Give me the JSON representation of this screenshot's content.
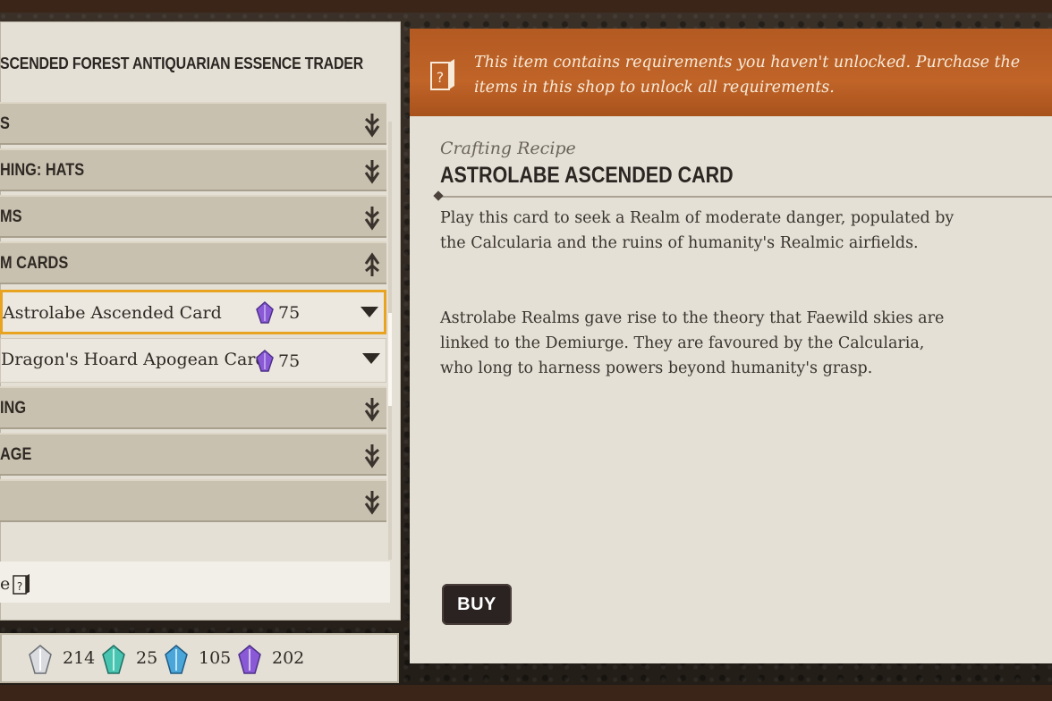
{
  "shop": {
    "title": "SCENDED FOREST ANTIQUARIAN ESSENCE TRADER",
    "categories_top": [
      {
        "label": "S",
        "chevron": "double-chevron-down-icon"
      },
      {
        "label": "HING: HATS",
        "chevron": "double-chevron-down-icon"
      },
      {
        "label": "MS",
        "chevron": "double-chevron-down-icon"
      },
      {
        "label": "M CARDS",
        "chevron": "double-chevron-up-icon"
      }
    ],
    "items": [
      {
        "label": "Astrolabe Ascended Card",
        "price": "75",
        "currency_icon": "purple-essence-icon",
        "selected": true
      },
      {
        "label": "Dragon's Hoard Apogean Card",
        "price": "75",
        "currency_icon": "purple-essence-icon",
        "selected": false
      }
    ],
    "categories_bottom": [
      {
        "label": "ING",
        "chevron": "double-chevron-down-icon"
      },
      {
        "label": "AGE",
        "chevron": "double-chevron-down-icon"
      },
      {
        "label": "",
        "chevron": "double-chevron-down-icon"
      }
    ],
    "locked_label": "e"
  },
  "currencies": [
    {
      "name": "white-essence-icon",
      "value": "214",
      "color": "#bfc3c8"
    },
    {
      "name": "teal-essence-icon",
      "value": "25",
      "color": "#49c4b0"
    },
    {
      "name": "blue-essence-icon",
      "value": "105",
      "color": "#4aa6d9"
    },
    {
      "name": "purple-essence-icon",
      "value": "202",
      "color": "#8a5ad6"
    }
  ],
  "detail": {
    "notice": "This item contains requirements you haven't unlocked. Purchase the items in this shop to unlock all requirements.",
    "type": "Crafting Recipe",
    "title": "ASTROLABE ASCENDED CARD",
    "desc1": "Play this card to seek a Realm of moderate danger, populated by the Calcularia and the ruins of humanity's Realmic airfields.",
    "desc2": "Astrolabe Realms gave rise to the theory that Faewild skies are linked to the Demiurge. They are favoured by the Calcularia, who long to harness powers beyond humanity's grasp.",
    "buy_label": "BUY"
  },
  "colors": {
    "accent_orange": "#e8a321",
    "notice_bg": "#b35a22",
    "panel_bg": "#e4e0d6"
  }
}
